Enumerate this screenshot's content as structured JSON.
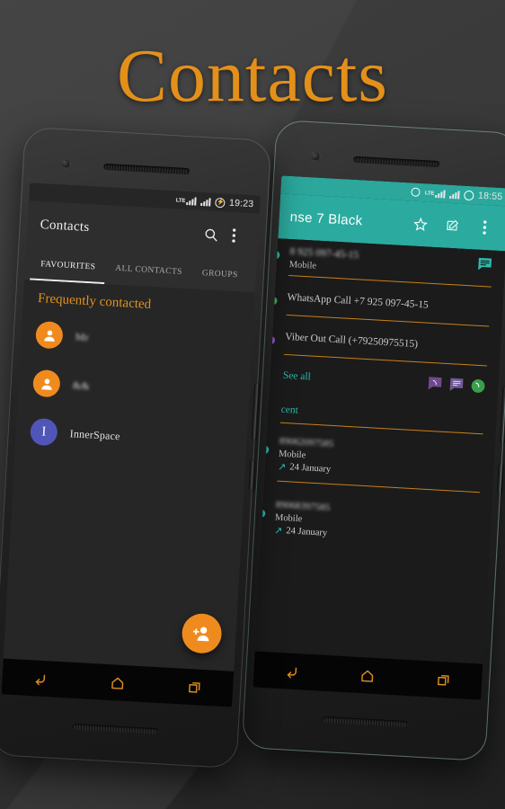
{
  "page": {
    "title": "Contacts",
    "title_color": "#e3901a",
    "background_color": "#3a3a3a"
  },
  "left_phone": {
    "statusbar": {
      "network_label": "LTE",
      "signal_icon": "signal-bars-icon",
      "signal_icon_2": "signal-bars-icon",
      "battery_icon": "battery-charging-icon",
      "clock": "19:23"
    },
    "appbar": {
      "title": "Contacts",
      "search_icon": "search-icon",
      "overflow_icon": "overflow-menu-icon"
    },
    "tabs": [
      {
        "label": "FAVOURITES",
        "active": true
      },
      {
        "label": "ALL CONTACTS",
        "active": false
      },
      {
        "label": "GROUPS",
        "active": false
      }
    ],
    "section_header": "Frequently contacted",
    "section_header_color": "#e0921f",
    "contacts": [
      {
        "name": "Mr",
        "avatar_type": "person-icon",
        "avatar_color": "#ef8b1e",
        "blurred": true
      },
      {
        "name": "&&",
        "avatar_type": "person-icon",
        "avatar_color": "#ef8b1e",
        "blurred": true
      },
      {
        "name": "InnerSpace",
        "avatar_type": "letter",
        "avatar_letter": "I",
        "avatar_color": "#4f56b8",
        "blurred": false
      }
    ],
    "fab": {
      "icon": "add-person-icon",
      "color": "#ef8b1e"
    },
    "navbar": {
      "back_icon": "back-arrow-icon",
      "home_icon": "home-icon",
      "recents_icon": "recents-icon",
      "icon_color": "#e2901f"
    }
  },
  "right_phone": {
    "statusbar": {
      "alarm_icon": "circle-icon",
      "network_label": "LTE",
      "signal_icon": "signal-bars-icon",
      "signal_icon_2": "signal-bars-icon",
      "battery_icon": "battery-circle-icon",
      "clock": "18:55"
    },
    "appbar": {
      "title": "nse 7 Black",
      "star_icon": "star-icon",
      "edit_icon": "edit-icon",
      "overflow_icon": "overflow-menu-icon",
      "color": "#2bab9f"
    },
    "details": [
      {
        "primary": "8 925 097-45-15",
        "secondary": "Mobile",
        "blurred": true,
        "dot_color": "#2cbcae",
        "action_icon": "message-icon",
        "action_icon_color": "#2cbcae"
      },
      {
        "primary": "WhatsApp Call +7 925 097-45-15",
        "secondary": "",
        "blurred": false,
        "blurred_tail": "925 097-45-15",
        "dot_color": "#4caf50"
      },
      {
        "primary": "Viber Out Call (+79250975515)",
        "secondary": "",
        "blurred": false,
        "blurred_tail": "79250975515",
        "dot_color": "#8e57c4"
      }
    ],
    "see_all": {
      "label": "See all",
      "color": "#2cbcae",
      "app_icons": [
        {
          "name": "viber-icon",
          "color": "#7b4397"
        },
        {
          "name": "message-icon",
          "color": "#7b5ea8"
        },
        {
          "name": "whatsapp-icon",
          "color": "#3b9e4c"
        }
      ]
    },
    "recent_header": "cent",
    "recent_header_color": "#2cbcae",
    "recent_calls": [
      {
        "number": "89062097585",
        "type": "Mobile",
        "date": "24 January",
        "direction_icon": "outgoing-call-icon",
        "dot_color": "#2cbcae"
      },
      {
        "number": "89068397585",
        "type": "Mobile",
        "date": "24 January",
        "direction_icon": "outgoing-call-icon",
        "dot_color": "#2cbcae"
      }
    ],
    "navbar": {
      "back_icon": "back-arrow-icon",
      "home_icon": "home-icon",
      "recents_icon": "recents-icon",
      "icon_color": "#e2901f"
    }
  }
}
